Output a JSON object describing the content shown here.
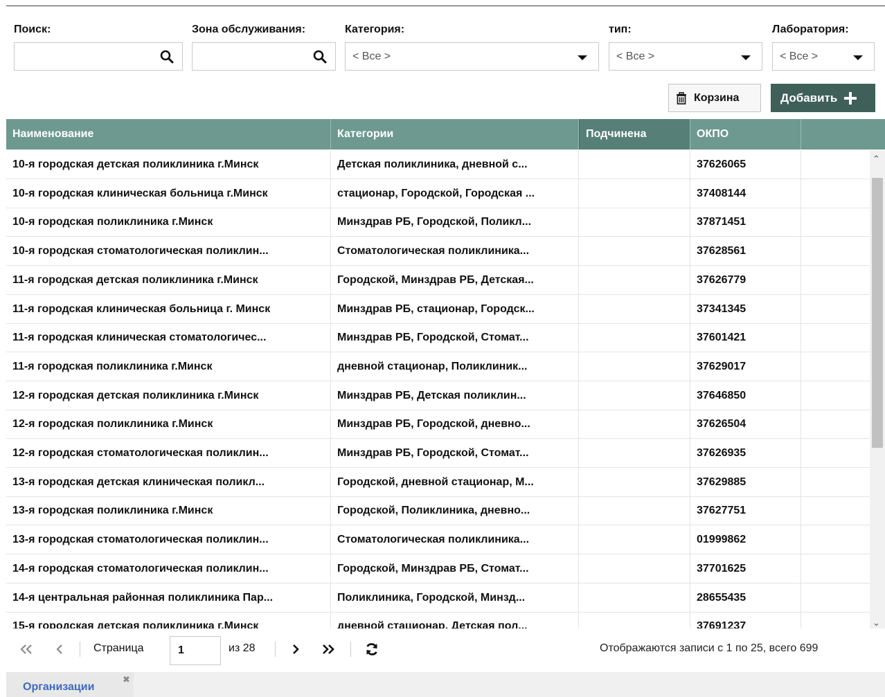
{
  "filters": {
    "search_label": "Поиск:",
    "zone_label": "Зона обслуживания:",
    "category_label": "Категория:",
    "category_value": "< Все >",
    "type_label": "тип:",
    "type_value": "< Все >",
    "lab_label": "Лаборатория:",
    "lab_value": "< Все >"
  },
  "toolbar": {
    "trash_label": "Корзина",
    "add_label": "Добавить"
  },
  "table": {
    "headers": [
      "Наименование",
      "Категории",
      "Подчинена",
      "ОКПО",
      ""
    ],
    "rows": [
      {
        "name": "10-я городская детская поликлиника г.Минск",
        "categories": "Детская поликлиника, дневной с...",
        "parent": "",
        "okpo": "37626065"
      },
      {
        "name": "10-я городская клиническая больница г.Минск",
        "categories": "стационар, Городской, Городская ...",
        "parent": "",
        "okpo": "37408144"
      },
      {
        "name": "10-я городская поликлиника г.Минск",
        "categories": "Минздрав РБ, Городской, Поликл...",
        "parent": "",
        "okpo": "37871451"
      },
      {
        "name": "10-я городская стоматологическая поликлин...",
        "categories": "Стоматологическая поликлиника...",
        "parent": "",
        "okpo": "37628561"
      },
      {
        "name": "11-я городская детская поликлиника г.Минск",
        "categories": "Городской, Минздрав РБ, Детская...",
        "parent": "",
        "okpo": "37626779"
      },
      {
        "name": "11-я городская клиническая больница г. Минск",
        "categories": "Минздрав РБ, стационар, Городск...",
        "parent": "",
        "okpo": "37341345"
      },
      {
        "name": "11-я городская клиническая стоматологичес...",
        "categories": "Минздрав РБ, Городской, Стомат...",
        "parent": "",
        "okpo": "37601421"
      },
      {
        "name": "11-я городская поликлиника г.Минск",
        "categories": "дневной стационар, Поликлиник...",
        "parent": "",
        "okpo": "37629017"
      },
      {
        "name": "12-я городская детская поликлиника г.Минск",
        "categories": "Минздрав РБ, Детская поликлин...",
        "parent": "",
        "okpo": "37646850"
      },
      {
        "name": "12-я городская поликлиника г.Минск",
        "categories": "Минздрав РБ, Городской, дневно...",
        "parent": "",
        "okpo": "37626504"
      },
      {
        "name": "12-я городская стоматологическая поликлин...",
        "categories": "Минздрав РБ, Городской, Стомат...",
        "parent": "",
        "okpo": "37626935"
      },
      {
        "name": "13-я городская детская клиническая поликл...",
        "categories": "Городской, дневной стационар, М...",
        "parent": "",
        "okpo": "37629885"
      },
      {
        "name": "13-я городская поликлиника г.Минск",
        "categories": "Городской, Поликлиника, дневно...",
        "parent": "",
        "okpo": "37627751"
      },
      {
        "name": "13-я городская стоматологическая поликлин...",
        "categories": "Стоматологическая поликлиника...",
        "parent": "",
        "okpo": "01999862"
      },
      {
        "name": "14-я городская стоматологическая поликлин...",
        "categories": "Городской, Минздрав РБ, Стомат...",
        "parent": "",
        "okpo": "37701625"
      },
      {
        "name": "14-я центральная районная поликлиника Пар...",
        "categories": "Поликлиника, Городской, Минзд...",
        "parent": "",
        "okpo": "28655435"
      },
      {
        "name": "15-я городская детская поликлиника г.Минск",
        "categories": "дневной стационар, Детская пол...",
        "parent": "",
        "okpo": "37691237"
      }
    ]
  },
  "pager": {
    "page_label": "Страница",
    "page_value": "1",
    "of_label": "из 28",
    "status": "Отображаются записи с 1 по 25, всего 699"
  },
  "tabs": [
    {
      "label": "Организации"
    }
  ],
  "colors": {
    "header_bg": "#6d9990",
    "add_button_bg": "#3f5f59",
    "tab_text": "#3d6abf"
  }
}
